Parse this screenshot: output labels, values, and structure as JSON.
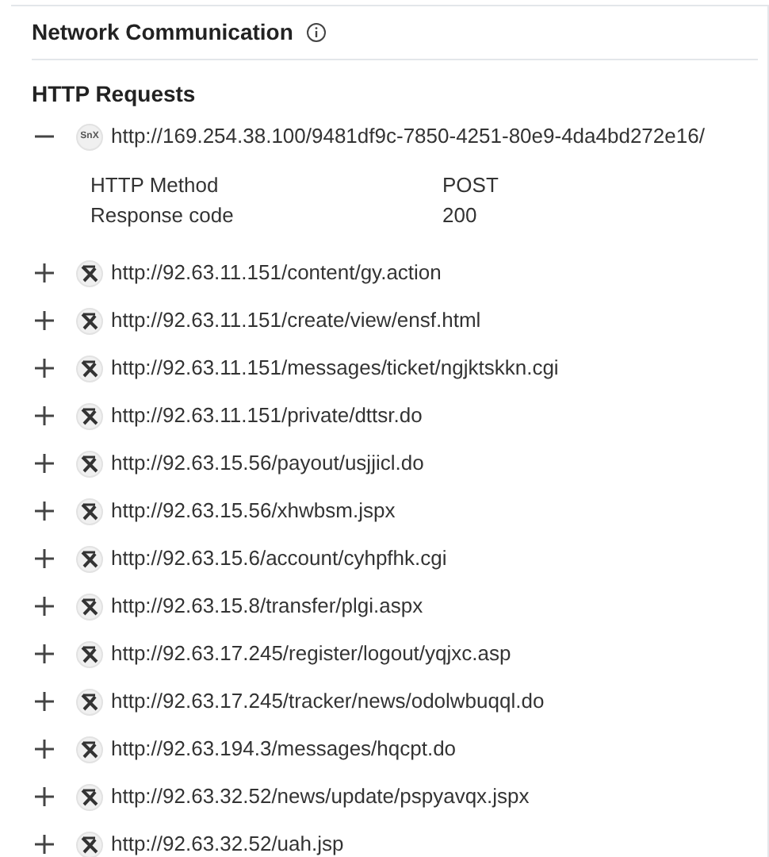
{
  "section": {
    "title": "Network Communication"
  },
  "group": {
    "title": "HTTP Requests"
  },
  "requests": [
    {
      "url": "http://169.254.38.100/9481df9c-7850-4251-80e9-4da4bd272e16/",
      "expanded": true,
      "kind": "text_logo",
      "logo_text": "SnX",
      "details": [
        {
          "label": "HTTP Method",
          "value": "POST"
        },
        {
          "label": "Response code",
          "value": "200"
        }
      ]
    },
    {
      "url": "http://92.63.11.151/content/gy.action",
      "expanded": false,
      "kind": "glyph_logo"
    },
    {
      "url": "http://92.63.11.151/create/view/ensf.html",
      "expanded": false,
      "kind": "glyph_logo"
    },
    {
      "url": "http://92.63.11.151/messages/ticket/ngjktskkn.cgi",
      "expanded": false,
      "kind": "glyph_logo"
    },
    {
      "url": "http://92.63.11.151/private/dttsr.do",
      "expanded": false,
      "kind": "glyph_logo"
    },
    {
      "url": "http://92.63.15.56/payout/usjjicl.do",
      "expanded": false,
      "kind": "glyph_logo"
    },
    {
      "url": "http://92.63.15.56/xhwbsm.jspx",
      "expanded": false,
      "kind": "glyph_logo"
    },
    {
      "url": "http://92.63.15.6/account/cyhpfhk.cgi",
      "expanded": false,
      "kind": "glyph_logo"
    },
    {
      "url": "http://92.63.15.8/transfer/plgi.aspx",
      "expanded": false,
      "kind": "glyph_logo"
    },
    {
      "url": "http://92.63.17.245/register/logout/yqjxc.asp",
      "expanded": false,
      "kind": "glyph_logo"
    },
    {
      "url": "http://92.63.17.245/tracker/news/odolwbuqql.do",
      "expanded": false,
      "kind": "glyph_logo"
    },
    {
      "url": "http://92.63.194.3/messages/hqcpt.do",
      "expanded": false,
      "kind": "glyph_logo"
    },
    {
      "url": "http://92.63.32.52/news/update/pspyavqx.jspx",
      "expanded": false,
      "kind": "glyph_logo"
    },
    {
      "url": "http://92.63.32.52/uah.jsp",
      "expanded": false,
      "kind": "glyph_logo"
    }
  ]
}
